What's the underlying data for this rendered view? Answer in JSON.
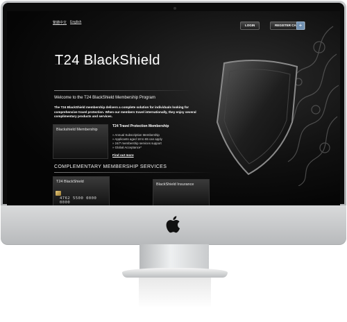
{
  "header": {
    "lang_zh": "繁體中文",
    "lang_en": "English",
    "login_label": "LOGIN",
    "register_label": "REGISTER CARD",
    "register_icon": "plus-icon"
  },
  "hero": {
    "title": "T24 BlackShield",
    "welcome": "Welcome to the T24 BlackShield Membership Program",
    "intro": "The T24 BlackShield membership delivers a complete solution for individuals looking for comprehensive travel protection. When our members travel internationally, they enjoy several complimentary products and services."
  },
  "promo": {
    "thumb_label": "Blackshield Membership",
    "title": "T24 Travel Protection Membership",
    "bullets": [
      "Annual Subscription Membership",
      "Applicants aged 18 to 65 can apply",
      "24/7 membership services support",
      "Global Acceptance*"
    ],
    "link": "Find out more"
  },
  "services": {
    "title": "COMPLEMENTARY MEMBERSHIP SERVICES",
    "card_label": "T24 BlackShield",
    "card_number": "4762 5500 0000 0000",
    "insurance_label": "BlackShield Insurance"
  },
  "colors": {
    "screen_bg": "#050505",
    "text": "#ffffff",
    "button_accent": "#6f8fb0"
  }
}
